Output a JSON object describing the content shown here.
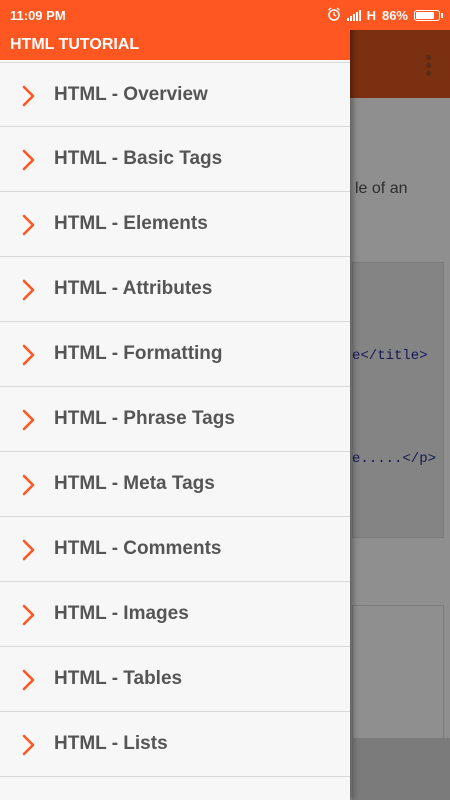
{
  "status_bar": {
    "time": "11:09 PM",
    "network": "H",
    "battery": "86%",
    "battery_level": 0.86
  },
  "drawer": {
    "title": "HTML TUTORIAL",
    "items": [
      {
        "label": "HTML - Overview"
      },
      {
        "label": "HTML - Basic Tags"
      },
      {
        "label": "HTML - Elements"
      },
      {
        "label": "HTML - Attributes"
      },
      {
        "label": "HTML - Formatting"
      },
      {
        "label": "HTML - Phrase Tags"
      },
      {
        "label": "HTML - Meta Tags"
      },
      {
        "label": "HTML - Comments"
      },
      {
        "label": "HTML - Images"
      },
      {
        "label": "HTML - Tables"
      },
      {
        "label": "HTML - Lists"
      }
    ]
  },
  "background": {
    "text_fragment": "le of an",
    "code_line_1": "e</title>",
    "code_line_2": "e.....</p>"
  },
  "colors": {
    "accent": "#ff5722",
    "chevron": "#ff5722",
    "label": "#555555"
  }
}
